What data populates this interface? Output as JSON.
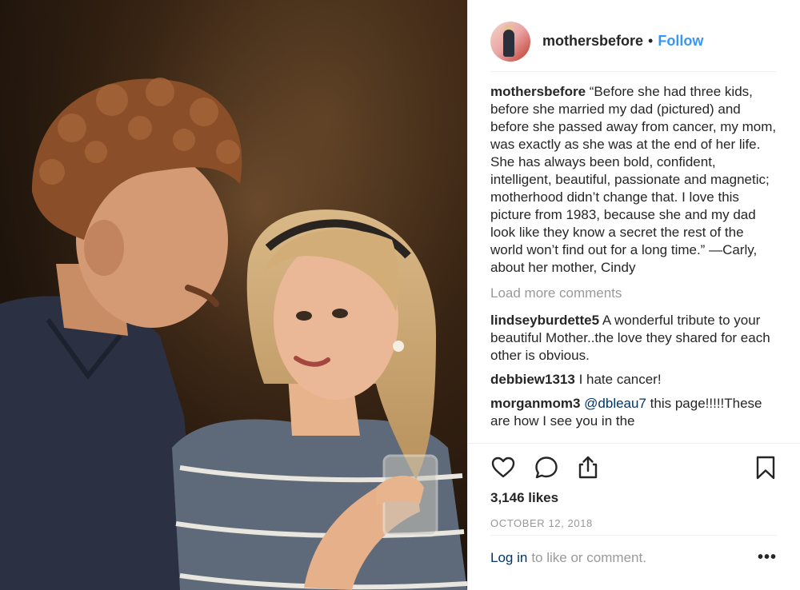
{
  "post": {
    "image_alt": "Vintage photo of a couple smiling at each other",
    "author": "mothersbefore",
    "separator": "•",
    "follow_label": "Follow"
  },
  "caption": {
    "username": "mothersbefore",
    "text": "“Before she had three kids, before she married my dad (pictured) and before she passed away from cancer, my mom, was exactly as she was at the end of her life. She has always been bold, confident, intelligent, beautiful, passionate and magnetic; motherhood didn’t change that. I love this picture from 1983, because she and my dad look like they know a secret the rest of the world won’t find out for a long time.” —Carly, about her mother, Cindy"
  },
  "load_more_label": "Load more comments",
  "comments": [
    {
      "username": "lindseyburdette5",
      "text": "A wonderful tribute to your beautiful Mother..the love they shared for each other is obvious."
    },
    {
      "username": "debbiew1313",
      "text": "I hate cancer!"
    },
    {
      "username": "morganmom3",
      "mention": "@dbleau7",
      "text": "this page!!!!!These are how I see you in the"
    }
  ],
  "actions": {
    "icons": [
      "heart-icon",
      "comment-icon",
      "share-icon",
      "bookmark-icon"
    ]
  },
  "likes": "3,146 likes",
  "date": "OCTOBER 12, 2018",
  "login": {
    "link": "Log in",
    "rest": "to like or comment.",
    "more": "•••"
  }
}
